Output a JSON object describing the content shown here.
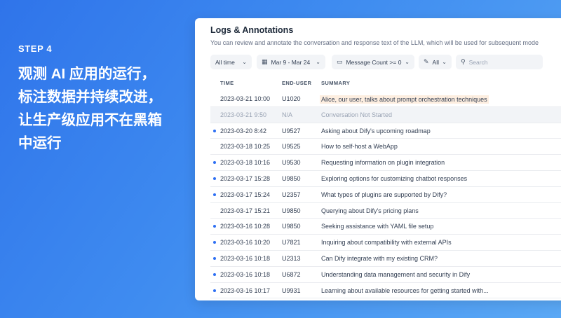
{
  "promo": {
    "step": "STEP 4",
    "headline_lines": [
      "观测 AI 应用的运行，",
      "标注数据并持续改进，",
      "让生产级应用不在黑箱",
      "中运行"
    ]
  },
  "app": {
    "title": "Logs & Annotations",
    "description": "You can review and annotate the conversation and response text of the LLM, which will be used for subsequent mode",
    "filters": {
      "period": "All time",
      "date_range": "Mar 9 - Mar 24",
      "message_count": "Message Count >= 0",
      "annotation": "All",
      "search_placeholder": "Search"
    },
    "columns": [
      "TIME",
      "END-USER",
      "SUMMARY"
    ],
    "rows": [
      {
        "time": "2023-03-21 10:00",
        "user": "U1020",
        "summary": "Alice, our user, talks about prompt orchestration techniques",
        "unread": false
      },
      {
        "time": "2023-03-21 9:50",
        "user": "N/A",
        "summary": "Conversation Not Started",
        "unread": false
      },
      {
        "time": "2023-03-20 8:42",
        "user": "U9527",
        "summary": "Asking about Dify's upcoming roadmap",
        "unread": true
      },
      {
        "time": "2023-03-18 10:25",
        "user": "U9525",
        "summary": "How to self-host a WebApp",
        "unread": false
      },
      {
        "time": "2023-03-18 10:16",
        "user": "U9530",
        "summary": "Requesting information on plugin integration",
        "unread": true
      },
      {
        "time": "2023-03-17 15:28",
        "user": "U9850",
        "summary": "Exploring options for customizing chatbot responses",
        "unread": true
      },
      {
        "time": "2023-03-17 15:24",
        "user": "U2357",
        "summary": "What types of plugins are supported by Dify?",
        "unread": true
      },
      {
        "time": "2023-03-17 15:21",
        "user": "U9850",
        "summary": "Querying about Dify's pricing plans",
        "unread": false
      },
      {
        "time": "2023-03-16 10:28",
        "user": "U9850",
        "summary": "Seeking assistance with YAML file setup",
        "unread": true
      },
      {
        "time": "2023-03-16 10:20",
        "user": "U7821",
        "summary": "Inquiring about compatibility with external APIs",
        "unread": true
      },
      {
        "time": "2023-03-16 10:18",
        "user": "U2313",
        "summary": "Can Dify integrate with my existing CRM?",
        "unread": true
      },
      {
        "time": "2023-03-16 10:18",
        "user": "U6872",
        "summary": "Understanding data management and security in Dify",
        "unread": true
      },
      {
        "time": "2023-03-16 10:17",
        "user": "U9931",
        "summary": "Learning about available resources for getting started with...",
        "unread": true
      }
    ]
  }
}
